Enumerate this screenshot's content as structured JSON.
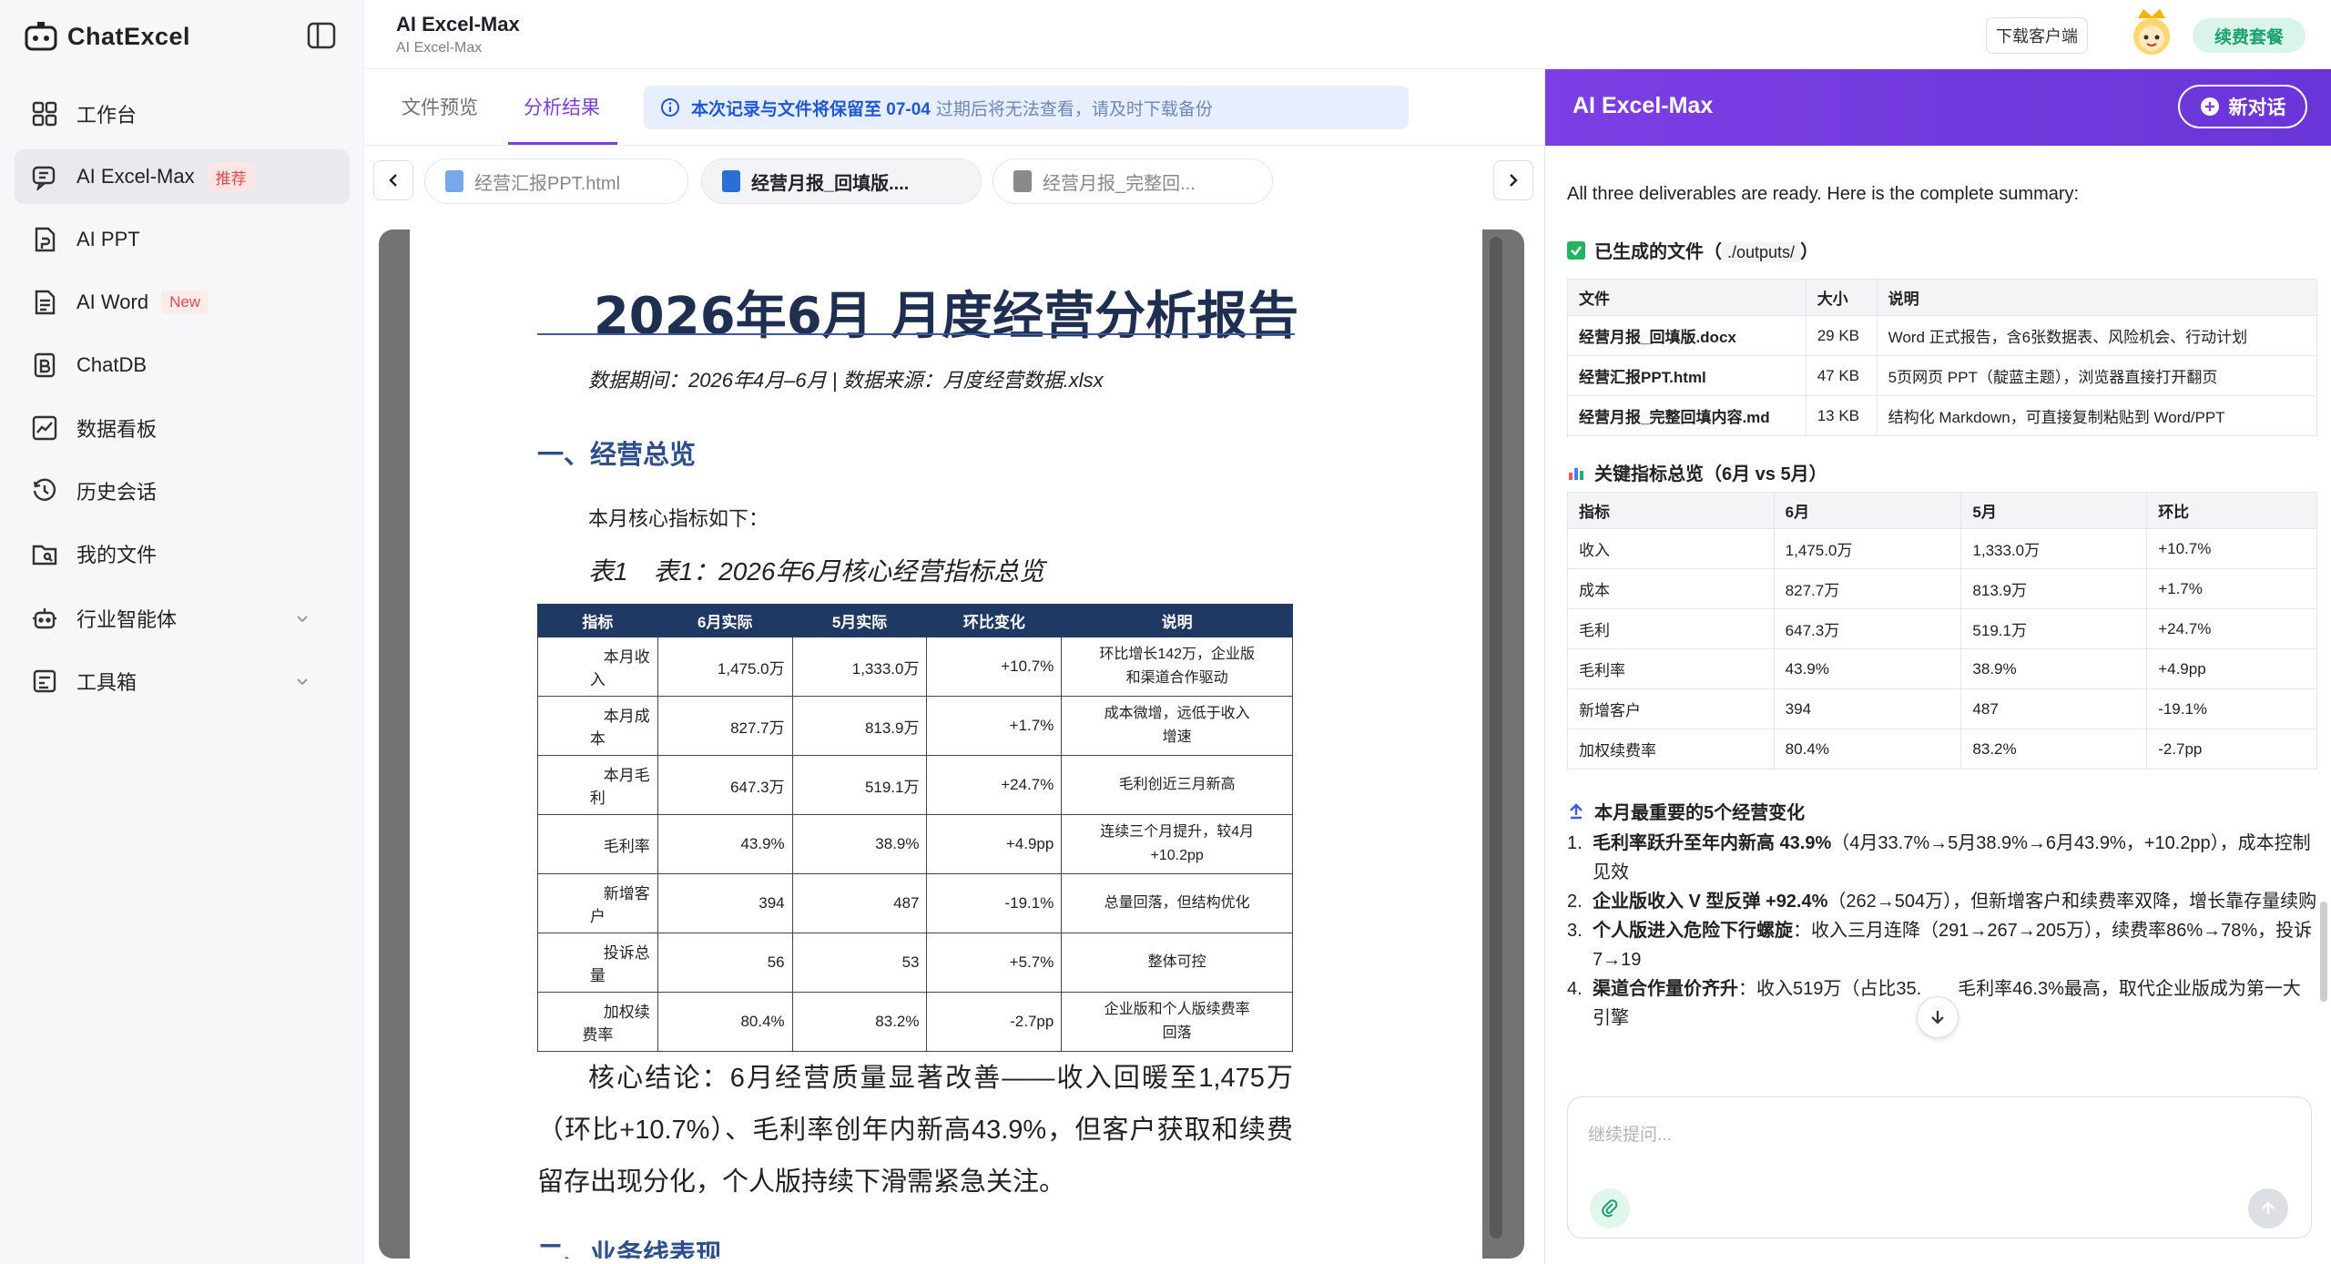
{
  "app": {
    "brand": "ChatExcel"
  },
  "sidebar": {
    "items": [
      {
        "label": "工作台"
      },
      {
        "label": "AI Excel-Max",
        "badge": "推荐"
      },
      {
        "label": "AI PPT"
      },
      {
        "label": "AI Word",
        "badge": "New"
      },
      {
        "label": "ChatDB"
      },
      {
        "label": "数据看板"
      },
      {
        "label": "历史会话"
      },
      {
        "label": "我的文件"
      },
      {
        "label": "行业智能体"
      },
      {
        "label": "工具箱"
      }
    ]
  },
  "header": {
    "title": "AI Excel-Max",
    "subtitle": "AI Excel-Max",
    "download_label": "下载客户端",
    "renew_label": "续费套餐"
  },
  "tabs": {
    "preview": "文件预览",
    "analysis": "分析结果",
    "notice_strong": "本次记录与文件将保留至 07-04",
    "notice_weak": "过期后将无法查看，请及时下载备份"
  },
  "files": [
    {
      "name": "经营汇报PPT.html"
    },
    {
      "name": "经营月报_回填版...."
    },
    {
      "name": "经营月报_完整回..."
    }
  ],
  "document": {
    "title": "2026年6月 月度经营分析报告",
    "meta": "数据期间：2026年4月–6月 | 数据来源：月度经营数据.xlsx",
    "section1": "一、经营总览",
    "intro": "本月核心指标如下：",
    "caption": "表1　表1：2026年6月核心经营指标总览",
    "headers": [
      "指标",
      "6月实际",
      "5月实际",
      "环比变化",
      "说明"
    ],
    "rows": [
      {
        "l1": "本月收",
        "l2": "入",
        "jun": "1,475.0万",
        "may": "1,333.0万",
        "chg": "+10.7%",
        "n1": "环比增长142万，企业版",
        "n2": "和渠道合作驱动"
      },
      {
        "l1": "本月成",
        "l2": "本",
        "jun": "827.7万",
        "may": "813.9万",
        "chg": "+1.7%",
        "n1": "成本微增，远低于收入",
        "n2": "增速"
      },
      {
        "l1": "本月毛",
        "l2": "利",
        "jun": "647.3万",
        "may": "519.1万",
        "chg": "+24.7%",
        "n1": "毛利创近三月新高",
        "n2": ""
      },
      {
        "l1": "毛利率",
        "l2": "",
        "jun": "43.9%",
        "may": "38.9%",
        "chg": "+4.9pp",
        "n1": "连续三个月提升，较4月",
        "n2": "+10.2pp"
      },
      {
        "l1": "新增客",
        "l2": "户",
        "jun": "394",
        "may": "487",
        "chg": "-19.1%",
        "n1": "总量回落，但结构优化",
        "n2": ""
      },
      {
        "l1": "投诉总",
        "l2": "量",
        "jun": "56",
        "may": "53",
        "chg": "+5.7%",
        "n1": "整体可控",
        "n2": ""
      },
      {
        "l1": "加权续",
        "l2": "费率",
        "jun": "80.4%",
        "may": "83.2%",
        "chg": "-2.7pp",
        "n1": "企业版和个人版续费率",
        "n2": "回落"
      }
    ],
    "conclusion": "核心结论：6月经营质量显著改善——收入回暖至1,475万（环比+10.7%）、毛利率创年内新高43.9%，但客户获取和续费留存出现分化，个人版持续下滑需紧急关注。",
    "section2": "二、业务线表现"
  },
  "chat": {
    "title": "AI Excel-Max",
    "new_chat": "新对话",
    "summary": "All three deliverables are ready. Here is the complete summary:",
    "files_heading": "已生成的文件（",
    "files_path": "./outputs/",
    "files_heading_end": "）",
    "files_headers": [
      "文件",
      "大小",
      "说明"
    ],
    "files_rows": [
      {
        "file": "经营月报_回填版.docx",
        "size": "29 KB",
        "desc": "Word 正式报告，含6张数据表、风险机会、行动计划"
      },
      {
        "file": "经营汇报PPT.html",
        "size": "47 KB",
        "desc": "5页网页 PPT（靛蓝主题），浏览器直接打开翻页"
      },
      {
        "file": "经营月报_完整回填内容.md",
        "size": "13 KB",
        "desc": "结构化 Markdown，可直接复制粘贴到 Word/PPT"
      }
    ],
    "kpi_heading": "关键指标总览（6月 vs 5月）",
    "kpi_headers": [
      "指标",
      "6月",
      "5月",
      "环比"
    ],
    "kpi_rows": [
      {
        "k": "收入",
        "jun": "1,475.0万",
        "may": "1,333.0万",
        "chg": "+10.7%"
      },
      {
        "k": "成本",
        "jun": "827.7万",
        "may": "813.9万",
        "chg": "+1.7%"
      },
      {
        "k": "毛利",
        "jun": "647.3万",
        "may": "519.1万",
        "chg": "+24.7%"
      },
      {
        "k": "毛利率",
        "jun": "43.9%",
        "may": "38.9%",
        "chg": "+4.9pp"
      },
      {
        "k": "新增客户",
        "jun": "394",
        "may": "487",
        "chg": "-19.1%"
      },
      {
        "k": "加权续费率",
        "jun": "80.4%",
        "may": "83.2%",
        "chg": "-2.7pp"
      }
    ],
    "changes_heading": "本月最重要的5个经营变化",
    "changes": [
      {
        "n": "1.",
        "bold": "毛利率跃升至年内新高 43.9%",
        "text": "（4月33.7%→5月38.9%→6月43.9%，+10.2pp），成本控制见效"
      },
      {
        "n": "2.",
        "bold": "企业版收入 V 型反弹 +92.4%",
        "text": "（262→504万），但新增客户和续费率双降，增长靠存量续购"
      },
      {
        "n": "3.",
        "bold": "个人版进入危险下行螺旋",
        "text": "：收入三月连降（291→267→205万），续费率86%→78%，投诉7→19"
      },
      {
        "n": "4.",
        "bold": "渠道合作量价齐升",
        "text": "：收入519万（占比35.　　毛利率46.3%最高，取代企业版成为第一大引擎"
      }
    ],
    "input_placeholder": "继续提问..."
  }
}
